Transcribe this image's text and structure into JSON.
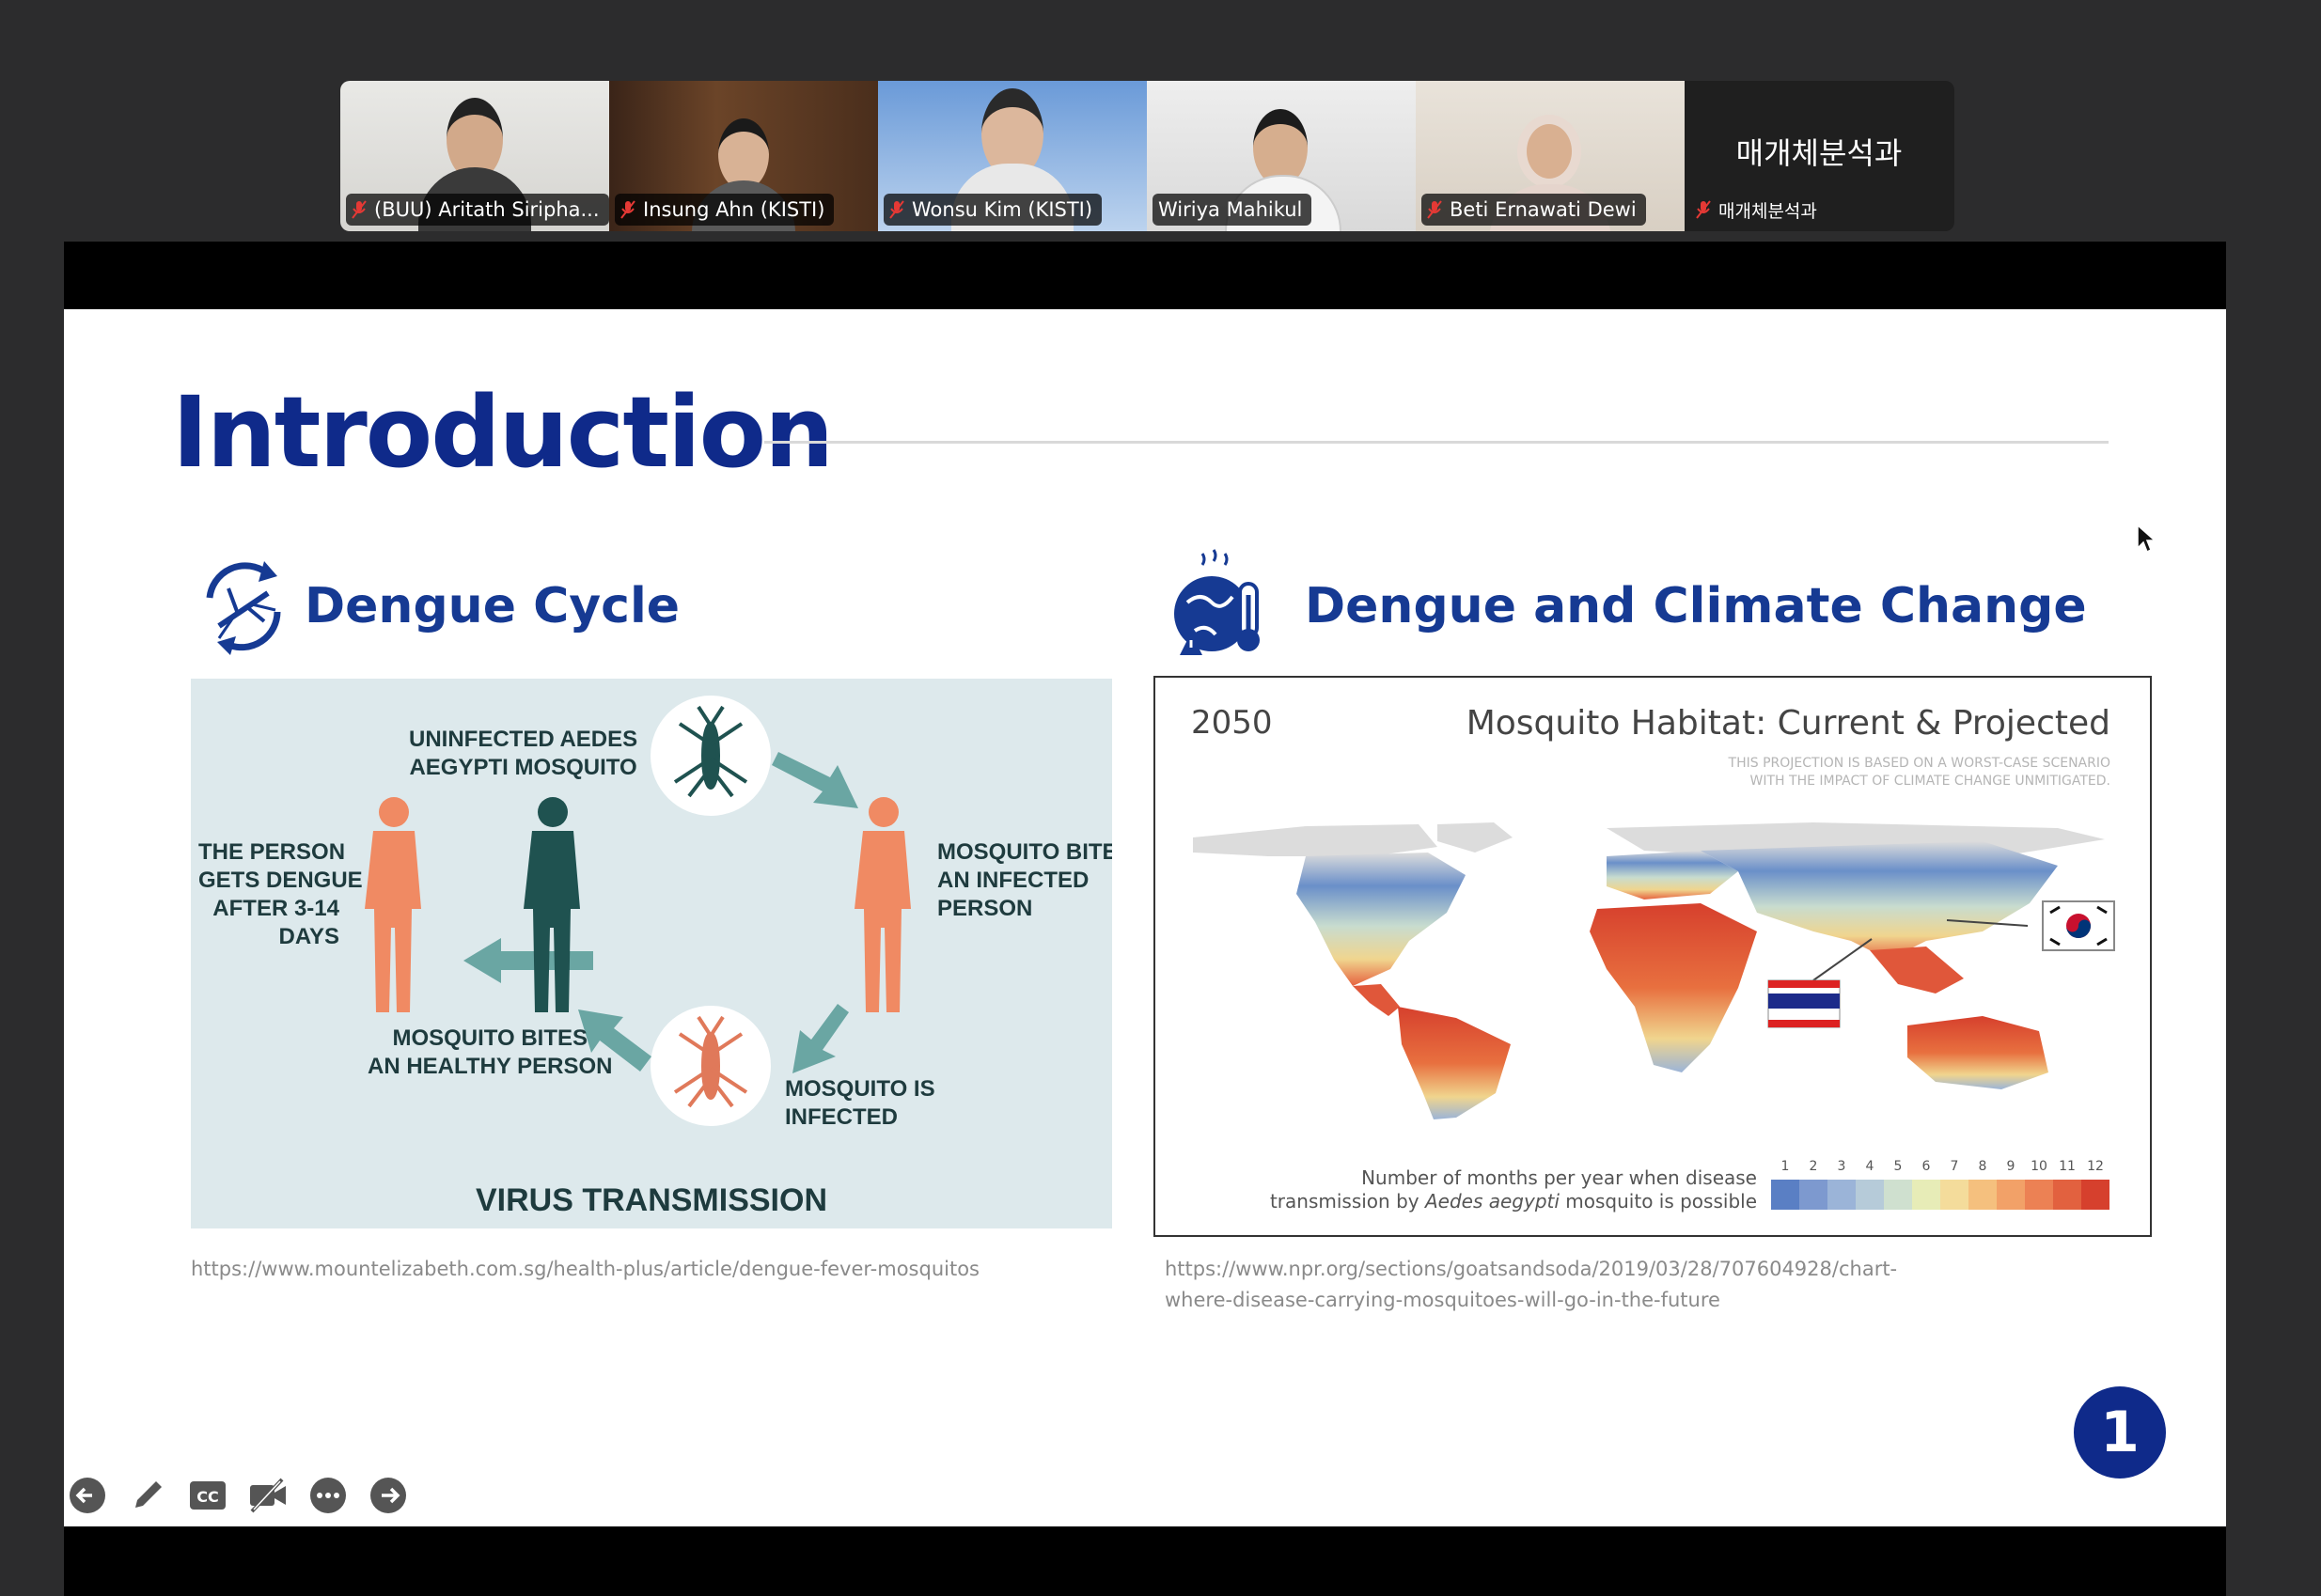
{
  "participants": [
    {
      "name": "(BUU) Aritath Siripha...",
      "active": false
    },
    {
      "name": "Insung Ahn (KISTI)",
      "active": false
    },
    {
      "name": "Wonsu Kim (KISTI)",
      "active": false
    },
    {
      "name": "Wiriya Mahikul",
      "active": true
    },
    {
      "name": "Beti Ernawati Dewi",
      "active": false
    },
    {
      "name": "매개체분석과",
      "tile_text": "매개체분석과",
      "active": false
    }
  ],
  "slide": {
    "title": "Introduction",
    "left_heading": "Dengue Cycle",
    "right_heading": "Dengue and Climate Change",
    "cycle": {
      "uninfected": "UNINFECTED AEDES\nAEGYPTI MOSQUITO",
      "bites_infected": "MOSQUITO BITES\nAN INFECTED\nPERSON",
      "is_infected": "MOSQUITO IS\nINFECTED",
      "bites_healthy": "MOSQUITO BITES\nAN HEALTHY PERSON",
      "gets_dengue": "THE PERSON\nGETS DENGUE\nAFTER 3-14\nDAYS",
      "title": "VIRUS TRANSMISSION"
    },
    "map": {
      "year": "2050",
      "title": "Mosquito Habitat: Current & Projected",
      "subtitle": "THIS PROJECTION IS BASED ON A WORST-CASE SCENARIO\nWITH THE IMPACT OF CLIMATE CHANGE UNMITIGATED.",
      "legend_caption_1": "Number of months per year when disease",
      "legend_caption_2a": "transmission by ",
      "legend_caption_2b": "Aedes aegypti",
      "legend_caption_2c": " mosquito is possible",
      "legend_values": [
        "1",
        "2",
        "3",
        "4",
        "5",
        "6",
        "7",
        "8",
        "9",
        "10",
        "11",
        "12"
      ],
      "legend_colors": [
        "#5a7fc4",
        "#7d99cf",
        "#9bb4d8",
        "#b6cbd9",
        "#cfe0cf",
        "#e7ecb7",
        "#f4dc9b",
        "#f5c07e",
        "#f2a168",
        "#ec8154",
        "#e2613f",
        "#d6402d"
      ]
    },
    "source_left": "https://www.mountelizabeth.com.sg/health-plus/article/dengue-fever-mosquitos",
    "source_right_1": "https://www.npr.org/sections/goatsandsoda/2019/03/28/707604928/chart-",
    "source_right_2": "where-disease-carrying-mosquitoes-will-go-in-the-future",
    "page_number": "1"
  },
  "toolbar": [
    "previous-slide-icon",
    "pen-icon",
    "captions-icon",
    "video-off-icon",
    "more-icon",
    "next-slide-icon"
  ]
}
